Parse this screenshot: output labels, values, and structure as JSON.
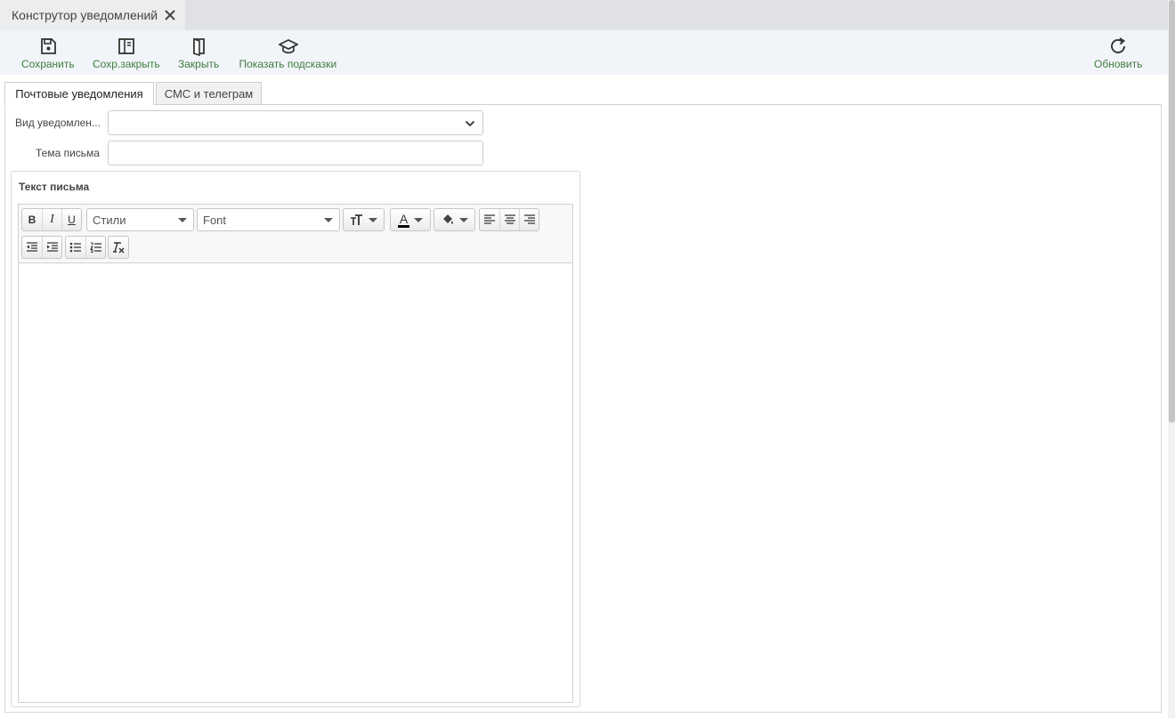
{
  "window": {
    "tab_title": "Конструтор уведомлений",
    "close_icon": "close-icon"
  },
  "toolbar": {
    "save_label": "Сохранить",
    "save_close_label": "Сохр.закрыть",
    "close_label": "Закрыть",
    "hints_label": "Показать подсказки",
    "refresh_label": "Обновить",
    "label_color": "#3f7d3f",
    "icons": [
      "floppy-icon",
      "save-close-icon",
      "door-icon",
      "graduation-cap-icon",
      "refresh-icon"
    ]
  },
  "tabs": {
    "email_label": "Почтовые уведомления",
    "sms_label": "СМС и телеграм",
    "active": "email"
  },
  "form": {
    "type_label": "Вид уведомлен...",
    "type_value": "",
    "subject_label": "Тема письма",
    "subject_value": ""
  },
  "editor": {
    "group_title": "Текст письма",
    "bold": "B",
    "italic": "I",
    "underline": "U",
    "styles_combo": "Стили",
    "font_combo": "Font",
    "font_color_letter": "A",
    "content": ""
  }
}
